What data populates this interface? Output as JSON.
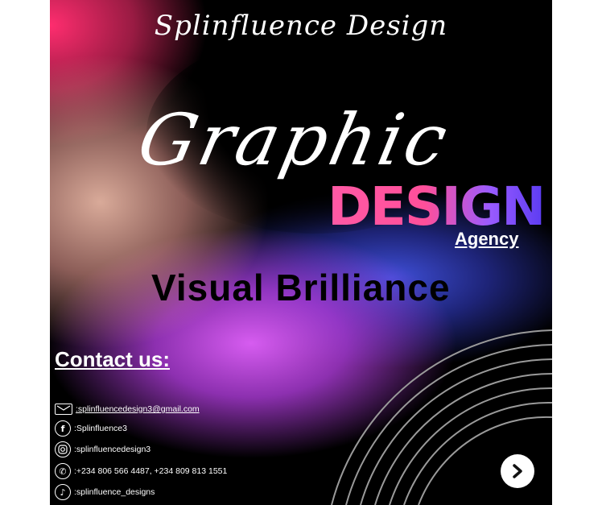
{
  "brand": {
    "name": "Splinfluence Design"
  },
  "headline": {
    "script_word": "Graphic",
    "bold_word": "DESIGN",
    "sub_word": "Agency"
  },
  "tagline": "Visual Brilliance",
  "contact": {
    "title": "Contact us:",
    "items": [
      {
        "icon": "mail-icon",
        "text": ":splinfluencedesign3@gmail.com"
      },
      {
        "icon": "facebook-icon",
        "text": ":Splinfluence3"
      },
      {
        "icon": "instagram-icon",
        "text": ":splinfluencedesign3"
      },
      {
        "icon": "phone-icon",
        "text": ":+234 806 566 4487, +234 809 813 1551"
      },
      {
        "icon": "tiktok-icon",
        "text": ":splinfluence_designs"
      }
    ]
  },
  "next_button": {
    "icon": "chevron-right-icon"
  },
  "colors": {
    "background": "#000000",
    "text": "#ffffff",
    "accent_pink": "#ff4f9a",
    "accent_purple": "#9a5bff",
    "accent_blue": "#3f4fd8"
  }
}
